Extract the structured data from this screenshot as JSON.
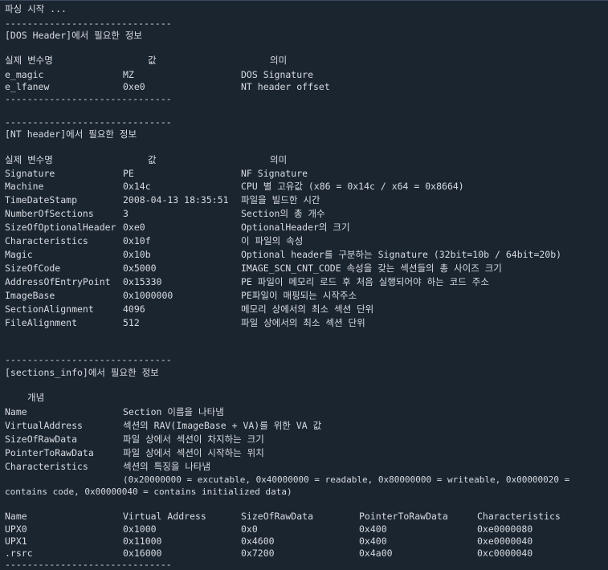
{
  "colors": {
    "background": "#1b2530",
    "text": "#d7dbe0"
  },
  "terminal": {
    "start": "파싱 시작 ...",
    "divider": "------------------------------",
    "dos": {
      "title": "[DOS Header]에서 필요한 정보",
      "headers": {
        "name": "실제 변수명",
        "value": "값",
        "meaning": "의미"
      },
      "rows": [
        {
          "name": "e_magic",
          "value": "MZ",
          "meaning": "DOS Signature"
        },
        {
          "name": "e_lfanew",
          "value": "0xe0",
          "meaning": "NT header offset"
        }
      ]
    },
    "nt": {
      "title": "[NT header]에서 필요한 정보",
      "headers": {
        "name": "실제 변수명",
        "value": "값",
        "meaning": "의미"
      },
      "rows": [
        {
          "name": "Signature",
          "value": "PE",
          "meaning": "NF Signature"
        },
        {
          "name": "Machine",
          "value": "0x14c",
          "meaning": "CPU 별 고유값 (x86 = 0x14c / x64 = 0x8664)"
        },
        {
          "name": "TimeDateStamp",
          "value": "2008-04-13 18:35:51",
          "meaning": "파일을 빌드한 시간"
        },
        {
          "name": "NumberOfSections",
          "value": "3",
          "meaning": "Section의 총 개수"
        },
        {
          "name": "SizeOfOptionalHeader",
          "value": "0xe0",
          "meaning": "OptionalHeader의 크기"
        },
        {
          "name": "Characteristics",
          "value": "0x10f",
          "meaning": "이 파일의 속성"
        },
        {
          "name": "Magic",
          "value": "0x10b",
          "meaning": "Optional header를 구분하는 Signature (32bit=10b / 64bit=20b)"
        },
        {
          "name": "SizeOfCode",
          "value": "0x5000",
          "meaning": "IMAGE_SCN_CNT_CODE 속성을 갖는 섹션들의 총 사이즈 크기"
        },
        {
          "name": "AddressOfEntryPoint",
          "value": "0x15330",
          "meaning": "PE 파일이 메모리 로드 후 처음 실행되어야 하는 코드 주소"
        },
        {
          "name": "ImageBase",
          "value": "0x1000000",
          "meaning": "PE파일이 매핑되는 시작주소"
        },
        {
          "name": "SectionAlignment",
          "value": "4096",
          "meaning": "메모리 상에서의 최소 섹션 단위"
        },
        {
          "name": "FileAlignment",
          "value": "512",
          "meaning": "파일 상에서의 최소 섹션 단위"
        }
      ]
    },
    "sections": {
      "title": "[sections_info]에서 필요한 정보",
      "concept": "개념",
      "concept_rows": [
        {
          "name": "Name",
          "meaning": "Section 이름을 나타냄"
        },
        {
          "name": "VirtualAddress",
          "meaning": "섹션의 RAV(ImageBase + VA)를 위한 VA 값"
        },
        {
          "name": "SizeOfRawData",
          "meaning": "파일 상에서 섹션이 차지하는 크기"
        },
        {
          "name": "PointerToRawData",
          "meaning": "파일 상에서 섹션이 시작하는 위치"
        },
        {
          "name": "Characteristics",
          "meaning": "섹션의 특징을 나타냄"
        }
      ],
      "char_note_1": "(0x20000000 = excutable, 0x40000000 = readable, 0x80000000 = writeable, 0x00000020 =",
      "char_note_2": "contains code, 0x00000040 = contains initialized data)",
      "table_headers": [
        "Name",
        "Virtual Address",
        "SizeOfRawData",
        "PointerToRawData",
        "Characteristics"
      ],
      "table_rows": [
        [
          "UPX0",
          "0x1000",
          "0x0",
          "0x400",
          "0xe0000080"
        ],
        [
          "UPX1",
          "0x11000",
          "0x4600",
          "0x400",
          "0xe0000040"
        ],
        [
          ".rsrc",
          "0x16000",
          "0x7200",
          "0x4a00",
          "0xc0000040"
        ]
      ]
    }
  }
}
